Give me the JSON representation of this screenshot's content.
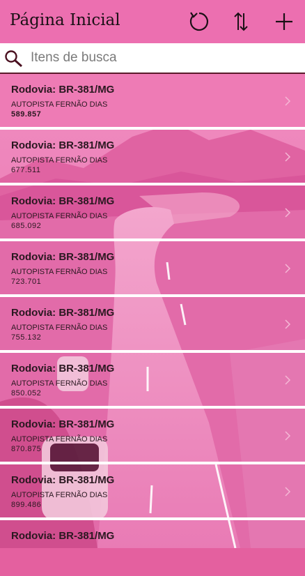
{
  "header": {
    "title": "Página Inicial",
    "refresh_icon": "refresh-icon",
    "sort_icon": "sort-icon",
    "add_icon": "plus-icon"
  },
  "search": {
    "placeholder": "Itens de busca",
    "value": ""
  },
  "colors": {
    "accent": "#ec6fb0",
    "separator": "#ffffff",
    "search_border": "#5a1a2a"
  },
  "items": [
    {
      "title": "Rodovia: BR-381/MG",
      "subtitle": "AUTOPISTA FERNÃO DIAS",
      "value": "589.857"
    },
    {
      "title": "Rodovia: BR-381/MG",
      "subtitle": "AUTOPISTA FERNÃO DIAS",
      "value": "677.511"
    },
    {
      "title": "Rodovia: BR-381/MG",
      "subtitle": "AUTOPISTA FERNÃO DIAS",
      "value": "685.092"
    },
    {
      "title": "Rodovia: BR-381/MG",
      "subtitle": "AUTOPISTA FERNÃO DIAS",
      "value": "723.701"
    },
    {
      "title": "Rodovia: BR-381/MG",
      "subtitle": "AUTOPISTA FERNÃO DIAS",
      "value": "755.132"
    },
    {
      "title": "Rodovia: BR-381/MG",
      "subtitle": "AUTOPISTA FERNÃO DIAS",
      "value": "850.052"
    },
    {
      "title": "Rodovia: BR-381/MG",
      "subtitle": "AUTOPISTA FERNÃO DIAS",
      "value": "870.875"
    },
    {
      "title": "Rodovia: BR-381/MG",
      "subtitle": "AUTOPISTA FERNÃO DIAS",
      "value": "899.486"
    },
    {
      "title": "Rodovia: BR-381/MG",
      "subtitle": "",
      "value": ""
    }
  ]
}
